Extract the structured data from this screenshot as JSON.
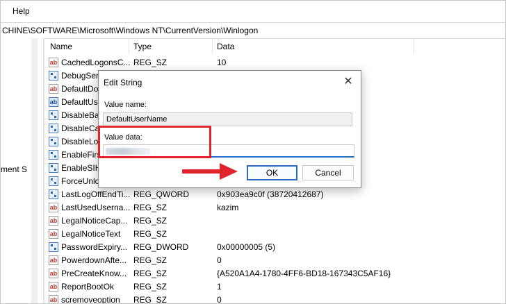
{
  "menubar": {
    "help": "Help"
  },
  "address": {
    "path": "CHINE\\SOFTWARE\\Microsoft\\Windows NT\\CurrentVersion\\Winlogon"
  },
  "tree": {
    "item_partial": "ment S"
  },
  "columns": {
    "name": "Name",
    "type": "Type",
    "data": "Data"
  },
  "rows": [
    {
      "name": "CachedLogonsC...",
      "type": "REG_SZ",
      "data": "10",
      "icon": "string-value-icon"
    },
    {
      "name": "DebugServ...",
      "type": "",
      "data": "",
      "icon": "binary-value-icon"
    },
    {
      "name": "DefaultDo",
      "type": "",
      "data": "",
      "icon": "string-value-icon"
    },
    {
      "name": "DefaultUs",
      "type": "",
      "data": "",
      "icon": "string-value-icon"
    },
    {
      "name": "DisableBa",
      "type": "",
      "data": "",
      "icon": "binary-value-icon"
    },
    {
      "name": "DisableCa",
      "type": "",
      "data": "",
      "icon": "binary-value-icon"
    },
    {
      "name": "DisableLo",
      "type": "",
      "data": "",
      "icon": "binary-value-icon"
    },
    {
      "name": "EnableFirs",
      "type": "",
      "data": "",
      "icon": "binary-value-icon"
    },
    {
      "name": "EnableSIH",
      "type": "",
      "data": "",
      "icon": "binary-value-icon"
    },
    {
      "name": "ForceUnlo",
      "type": "",
      "data": "",
      "icon": "binary-value-icon"
    },
    {
      "name": "LastLogOffEndTi...",
      "type": "REG_QWORD",
      "data": "0x903ea9c0f (38720412687)",
      "icon": "binary-value-icon"
    },
    {
      "name": "LastUsedUserna...",
      "type": "REG_SZ",
      "data": "kazim",
      "icon": "string-value-icon"
    },
    {
      "name": "LegalNoticeCap...",
      "type": "REG_SZ",
      "data": "",
      "icon": "string-value-icon"
    },
    {
      "name": "LegalNoticeText",
      "type": "REG_SZ",
      "data": "",
      "icon": "string-value-icon"
    },
    {
      "name": "PasswordExpiry...",
      "type": "REG_DWORD",
      "data": "0x00000005 (5)",
      "icon": "binary-value-icon"
    },
    {
      "name": "PowerdownAfte...",
      "type": "REG_SZ",
      "data": "0",
      "icon": "string-value-icon"
    },
    {
      "name": "PreCreateKnow...",
      "type": "REG_SZ",
      "data": "{A520A1A4-1780-4FF6-BD18-167343C5AF16}",
      "icon": "string-value-icon"
    },
    {
      "name": "ReportBootOk",
      "type": "REG_SZ",
      "data": "1",
      "icon": "string-value-icon"
    },
    {
      "name": "scremoveoption",
      "type": "REG_SZ",
      "data": "0",
      "icon": "string-value-icon"
    }
  ],
  "dialog": {
    "title": "Edit String",
    "close": "✕",
    "value_name_label": "Value name:",
    "value_name": "DefaultUserName",
    "value_data_label": "Value data:",
    "ok": "OK",
    "cancel": "Cancel"
  },
  "colors": {
    "highlight": "#e0242b",
    "accent": "#2a6cc4"
  }
}
